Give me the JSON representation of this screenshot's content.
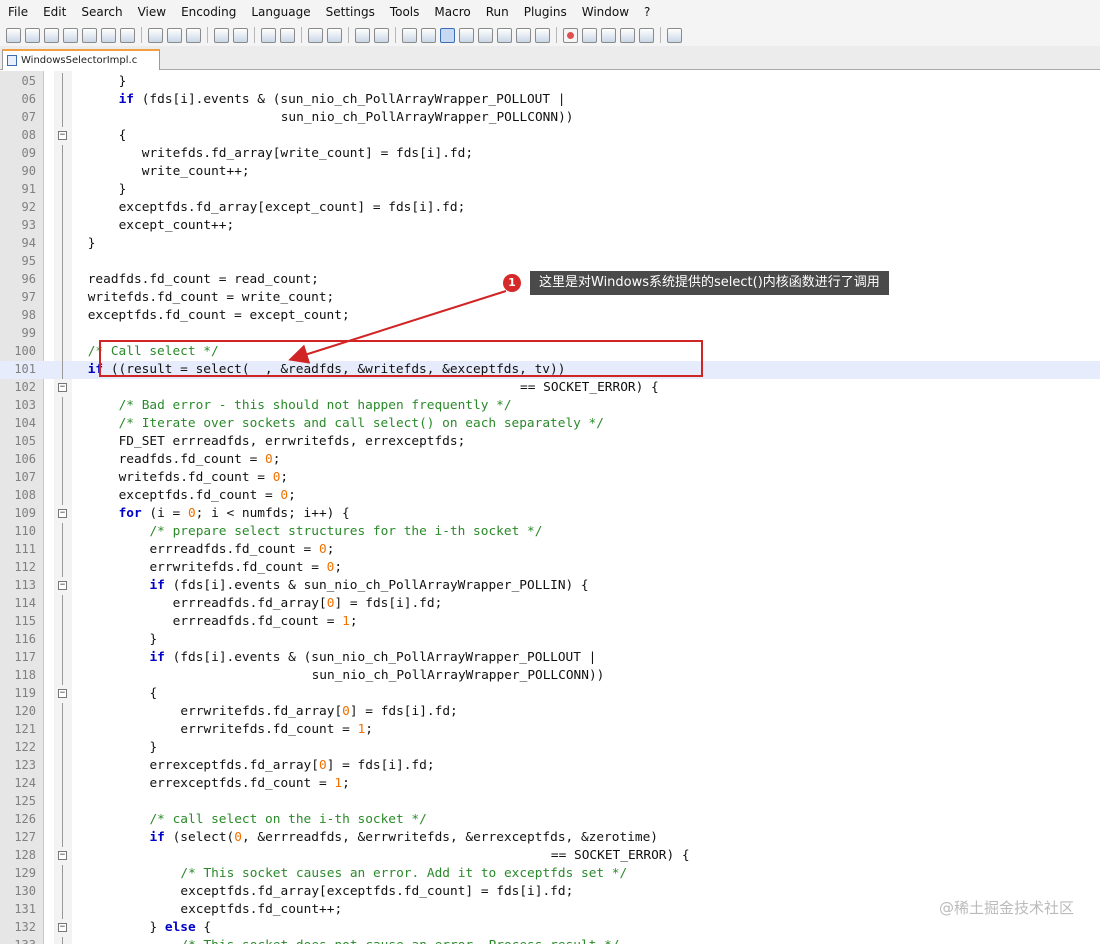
{
  "menu": [
    "File",
    "Edit",
    "Search",
    "View",
    "Encoding",
    "Language",
    "Settings",
    "Tools",
    "Macro",
    "Run",
    "Plugins",
    "Window",
    "?"
  ],
  "tab": {
    "filename": "WindowsSelectorImpl.c"
  },
  "annotation": {
    "badge": "1",
    "text": "这里是对Windows系统提供的select()内核函数进行了调用"
  },
  "watermark": "@稀土掘金技术社区",
  "lines": [
    {
      "n": "05",
      "indent": 5,
      "text": "}",
      "fold": "end"
    },
    {
      "n": "06",
      "indent": 5,
      "text": "if (fds[i].events & (sun_nio_ch_PollArrayWrapper_POLLOUT |",
      "fold": "line"
    },
    {
      "n": "07",
      "indent": 26,
      "text": "sun_nio_ch_PollArrayWrapper_POLLCONN))",
      "fold": "line"
    },
    {
      "n": "08",
      "indent": 5,
      "text": "{",
      "fold": "minus"
    },
    {
      "n": "09",
      "indent": 8,
      "text": "writefds.fd_array[write_count] = fds[i].fd;",
      "fold": "line"
    },
    {
      "n": "90",
      "indent": 8,
      "text": "write_count++;",
      "fold": "line"
    },
    {
      "n": "91",
      "indent": 5,
      "text": "}",
      "fold": "end"
    },
    {
      "n": "92",
      "indent": 5,
      "text": "exceptfds.fd_array[except_count] = fds[i].fd;",
      "fold": "line"
    },
    {
      "n": "93",
      "indent": 5,
      "text": "except_count++;",
      "fold": "line"
    },
    {
      "n": "94",
      "indent": 1,
      "text": "}",
      "fold": "end"
    },
    {
      "n": "95",
      "indent": 0,
      "text": "",
      "fold": "line"
    },
    {
      "n": "96",
      "indent": 1,
      "text": "readfds.fd_count = read_count;",
      "fold": "line"
    },
    {
      "n": "97",
      "indent": 1,
      "text": "writefds.fd_count = write_count;",
      "fold": "line"
    },
    {
      "n": "98",
      "indent": 1,
      "text": "exceptfds.fd_count = except_count;",
      "fold": "line"
    },
    {
      "n": "99",
      "indent": 0,
      "text": "",
      "fold": "line"
    },
    {
      "n": "100",
      "indent": 1,
      "text": "/* Call select */",
      "fold": "line"
    },
    {
      "n": "101",
      "indent": 1,
      "text": "if ((result = select(  , &readfds, &writefds, &exceptfds, tv))",
      "fold": "line"
    },
    {
      "n": "102",
      "indent": 57,
      "text": "== SOCKET_ERROR) {",
      "fold": "minus"
    },
    {
      "n": "103",
      "indent": 5,
      "text": "/* Bad error - this should not happen frequently */",
      "fold": "line"
    },
    {
      "n": "104",
      "indent": 5,
      "text": "/* Iterate over sockets and call select() on each separately */",
      "fold": "line"
    },
    {
      "n": "105",
      "indent": 5,
      "text": "FD_SET errreadfds, errwritefds, errexceptfds;",
      "fold": "line"
    },
    {
      "n": "106",
      "indent": 5,
      "text": "readfds.fd_count = 0;",
      "fold": "line"
    },
    {
      "n": "107",
      "indent": 5,
      "text": "writefds.fd_count = 0;",
      "fold": "line"
    },
    {
      "n": "108",
      "indent": 5,
      "text": "exceptfds.fd_count = 0;",
      "fold": "line"
    },
    {
      "n": "109",
      "indent": 5,
      "text": "for (i = 0; i < numfds; i++) {",
      "fold": "minus"
    },
    {
      "n": "110",
      "indent": 9,
      "text": "/* prepare select structures for the i-th socket */",
      "fold": "line"
    },
    {
      "n": "111",
      "indent": 9,
      "text": "errreadfds.fd_count = 0;",
      "fold": "line"
    },
    {
      "n": "112",
      "indent": 9,
      "text": "errwritefds.fd_count = 0;",
      "fold": "line"
    },
    {
      "n": "113",
      "indent": 9,
      "text": "if (fds[i].events & sun_nio_ch_PollArrayWrapper_POLLIN) {",
      "fold": "minus"
    },
    {
      "n": "114",
      "indent": 12,
      "text": "errreadfds.fd_array[0] = fds[i].fd;",
      "fold": "line"
    },
    {
      "n": "115",
      "indent": 12,
      "text": "errreadfds.fd_count = 1;",
      "fold": "line"
    },
    {
      "n": "116",
      "indent": 9,
      "text": "}",
      "fold": "end"
    },
    {
      "n": "117",
      "indent": 9,
      "text": "if (fds[i].events & (sun_nio_ch_PollArrayWrapper_POLLOUT |",
      "fold": "line"
    },
    {
      "n": "118",
      "indent": 30,
      "text": "sun_nio_ch_PollArrayWrapper_POLLCONN))",
      "fold": "line"
    },
    {
      "n": "119",
      "indent": 9,
      "text": "{",
      "fold": "minus"
    },
    {
      "n": "120",
      "indent": 13,
      "text": "errwritefds.fd_array[0] = fds[i].fd;",
      "fold": "line"
    },
    {
      "n": "121",
      "indent": 13,
      "text": "errwritefds.fd_count = 1;",
      "fold": "line"
    },
    {
      "n": "122",
      "indent": 9,
      "text": "}",
      "fold": "end"
    },
    {
      "n": "123",
      "indent": 9,
      "text": "errexceptfds.fd_array[0] = fds[i].fd;",
      "fold": "line"
    },
    {
      "n": "124",
      "indent": 9,
      "text": "errexceptfds.fd_count = 1;",
      "fold": "line"
    },
    {
      "n": "125",
      "indent": 0,
      "text": "",
      "fold": "line"
    },
    {
      "n": "126",
      "indent": 9,
      "text": "/* call select on the i-th socket */",
      "fold": "line"
    },
    {
      "n": "127",
      "indent": 9,
      "text": "if (select(0, &errreadfds, &errwritefds, &errexceptfds, &zerotime)",
      "fold": "line"
    },
    {
      "n": "128",
      "indent": 61,
      "text": "== SOCKET_ERROR) {",
      "fold": "minus"
    },
    {
      "n": "129",
      "indent": 13,
      "text": "/* This socket causes an error. Add it to exceptfds set */",
      "fold": "line"
    },
    {
      "n": "130",
      "indent": 13,
      "text": "exceptfds.fd_array[exceptfds.fd_count] = fds[i].fd;",
      "fold": "line"
    },
    {
      "n": "131",
      "indent": 13,
      "text": "exceptfds.fd_count++;",
      "fold": "line"
    },
    {
      "n": "132",
      "indent": 9,
      "text": "} else {",
      "fold": "minus"
    },
    {
      "n": "133",
      "indent": 13,
      "text": "/* This socket does not cause an error. Process result */",
      "fold": "line"
    }
  ]
}
